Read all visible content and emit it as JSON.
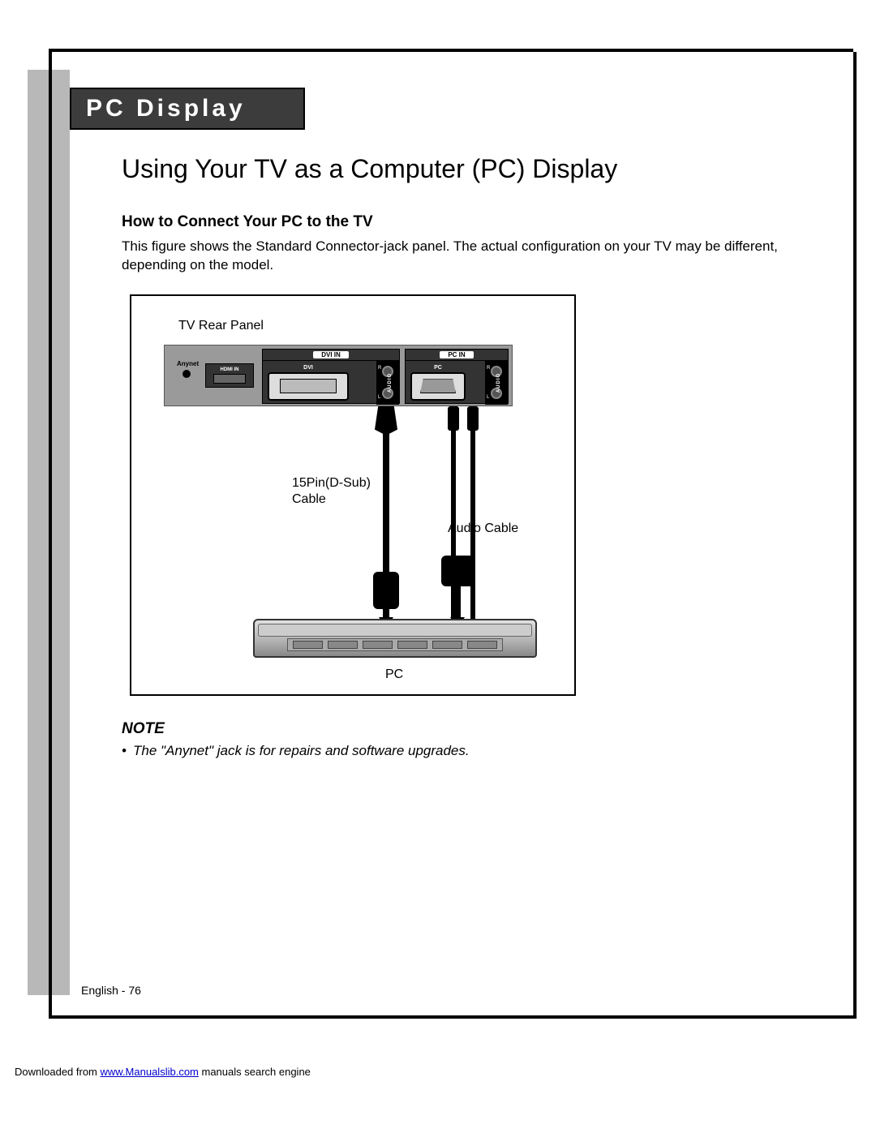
{
  "section_header": "PC Display",
  "main_title": "Using Your TV as a Computer (PC) Display",
  "subsection_title": "How to Connect Your PC to the TV",
  "intro_text": "This figure shows the Standard Connector-jack panel. The actual configuration on your TV may be different, depending on the model.",
  "figure": {
    "tv_rear_panel": "TV Rear Panel",
    "anynet": "Anynet",
    "hdmi_in": "HDMI IN",
    "dvi_in": "DVI IN",
    "dvi": "DVI",
    "pc_in": "PC IN",
    "pc_port": "PC",
    "audio": "AUDIO",
    "r": "R",
    "l": "L",
    "dsub_cable": "15Pin(D-Sub)",
    "cable": "Cable",
    "audio_cable": "Audio Cable",
    "pc": "PC"
  },
  "note_heading": "NOTE",
  "note_item": "The \"Anynet\" jack is for repairs and software upgrades.",
  "page_number": "English - 76",
  "footer_prefix": "Downloaded from ",
  "footer_link": "www.Manualslib.com",
  "footer_suffix": " manuals search engine"
}
